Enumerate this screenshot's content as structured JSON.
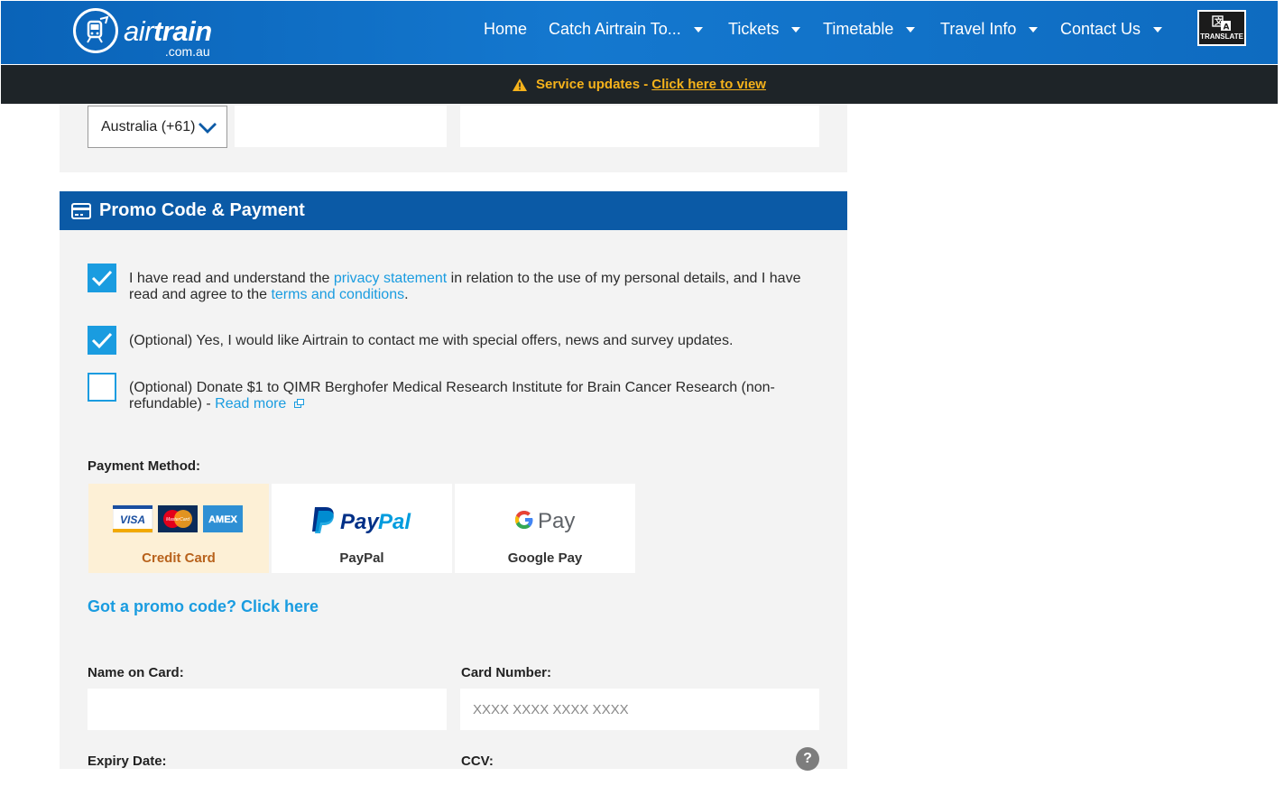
{
  "header": {
    "logo_main_light": "air",
    "logo_main_bold": "train",
    "logo_sub": ".com.au",
    "nav": [
      {
        "label": "Home",
        "dropdown": false
      },
      {
        "label": "Catch Airtrain To...",
        "dropdown": true
      },
      {
        "label": "Tickets",
        "dropdown": true
      },
      {
        "label": "Timetable",
        "dropdown": true
      },
      {
        "label": "Travel Info",
        "dropdown": true
      },
      {
        "label": "Contact Us",
        "dropdown": true
      }
    ],
    "translate_label": "TRANSLATE"
  },
  "alert": {
    "icon": "warning-icon",
    "text": "Service updates -",
    "link": "Click here to view"
  },
  "contact": {
    "country_code": "Australia (+61)"
  },
  "section": {
    "title": "Promo Code & Payment",
    "icon": "credit-card-icon"
  },
  "consents": [
    {
      "checked": true,
      "before": "I have read and understand the ",
      "link1": "privacy statement",
      "middle": " in relation to the use of my personal details, and I have read and agree to the ",
      "link2": "terms and conditions",
      "after": "."
    },
    {
      "checked": true,
      "text": "(Optional) Yes, I would like Airtrain to contact me with special offers, news and survey updates."
    },
    {
      "checked": false,
      "text": "(Optional) Donate $1 to QIMR Berghofer Medical Research Institute for Brain Cancer Research (non-refundable) - ",
      "link": "Read more"
    }
  ],
  "payment": {
    "label": "Payment Method:",
    "methods": [
      {
        "label": "Credit Card",
        "selected": true
      },
      {
        "label": "PayPal",
        "selected": false
      },
      {
        "label": "Google Pay",
        "selected": false
      }
    ],
    "card_logos": [
      "VISA",
      "MasterCard",
      "AMEX"
    ],
    "paypal_text_a": "Pay",
    "paypal_text_b": "Pal",
    "gpay_text": "Pay"
  },
  "promo_link": "Got a promo code? Click here",
  "card_form": {
    "name_label": "Name on Card:",
    "name_value": "",
    "number_label": "Card Number:",
    "number_placeholder": "XXXX XXXX XXXX XXXX",
    "expiry_label": "Expiry Date:",
    "ccv_label": "CCV:",
    "help_glyph": "?"
  },
  "colors": {
    "header_blue": "#0a63b8",
    "section_blue": "#0b5aa6",
    "accent_link": "#1a9ce0",
    "alert_bg": "#1e2428",
    "alert_text": "#f5b21b",
    "selected_method_bg": "#fdf0d6"
  }
}
